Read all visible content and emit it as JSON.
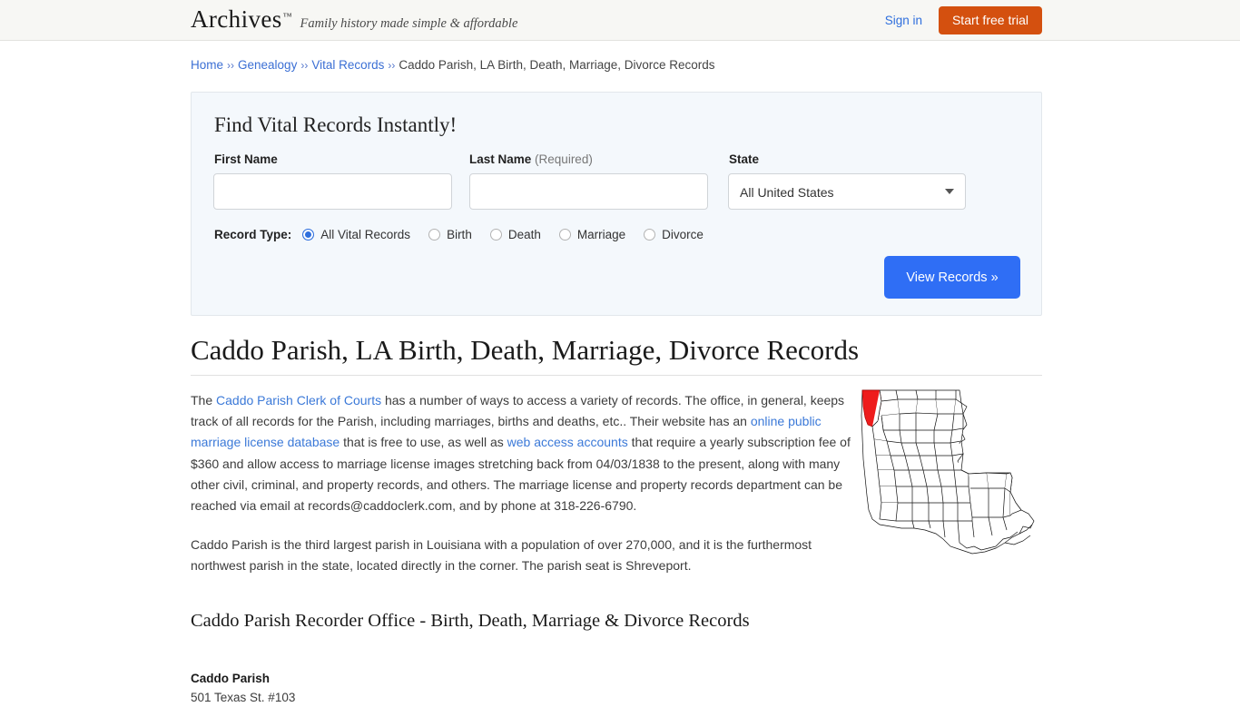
{
  "header": {
    "brand_name": "Archives",
    "brand_tm": "™",
    "tagline": "Family history made simple & affordable",
    "signin_label": "Sign in",
    "trial_label": "Start free trial",
    "trial_color": "#d4500f",
    "link_color": "#2f6fdd"
  },
  "breadcrumb": {
    "items": [
      {
        "label": "Home",
        "link": true
      },
      {
        "label": "Genealogy",
        "link": true
      },
      {
        "label": "Vital Records",
        "link": true
      },
      {
        "label": "Caddo Parish, LA Birth, Death, Marriage, Divorce Records",
        "link": false
      }
    ],
    "separator": "››"
  },
  "search_panel": {
    "title": "Find Vital Records Instantly!",
    "first_name": {
      "label": "First Name",
      "value": "",
      "placeholder": ""
    },
    "last_name": {
      "label": "Last Name",
      "required_note": "(Required)",
      "value": "",
      "placeholder": ""
    },
    "state": {
      "label": "State",
      "selected": "All United States",
      "options": [
        "All United States"
      ]
    },
    "record_type": {
      "caption": "Record Type:",
      "options": [
        {
          "label": "All Vital Records",
          "selected": true
        },
        {
          "label": "Birth",
          "selected": false
        },
        {
          "label": "Death",
          "selected": false
        },
        {
          "label": "Marriage",
          "selected": false
        },
        {
          "label": "Divorce",
          "selected": false
        }
      ]
    },
    "submit_label": "View Records »",
    "submit_color": "#2f6ef5"
  },
  "main": {
    "title": "Caddo Parish, LA Birth, Death, Marriage, Divorce Records",
    "paragraph1": {
      "t1": "The ",
      "link1": "Caddo Parish Clerk of Courts",
      "t2": " has a number of ways to access a variety of records. The office, in general, keeps track of all records for the Parish, including marriages, births and deaths, etc.. Their website has an ",
      "link2": "online public marriage license database",
      "t3": " that is free to use, as well as ",
      "link3": "web access accounts",
      "t4": " that require a yearly subscription fee of $360 and allow access to marriage license images stretching back from 04/03/1838 to the present, along with many other civil, criminal, and property records, and others. The marriage license and property records department can be reached via email at records@caddoclerk.com, and by phone at 318-226-6790."
    },
    "paragraph2": "Caddo Parish is the third largest parish in Louisiana with a population of over 270,000, and it is the furthermost northwest parish in the state, located directly in the corner. The parish seat is Shreveport.",
    "map": {
      "alt": "Map of Louisiana with Caddo Parish highlighted",
      "highlight_color": "#ee1c1c",
      "outline_color": "#111111"
    },
    "subheading": "Caddo Parish Recorder Office - Birth, Death, Marriage & Divorce Records",
    "office": {
      "name": "Caddo Parish",
      "street": "501 Texas St. #103"
    }
  }
}
